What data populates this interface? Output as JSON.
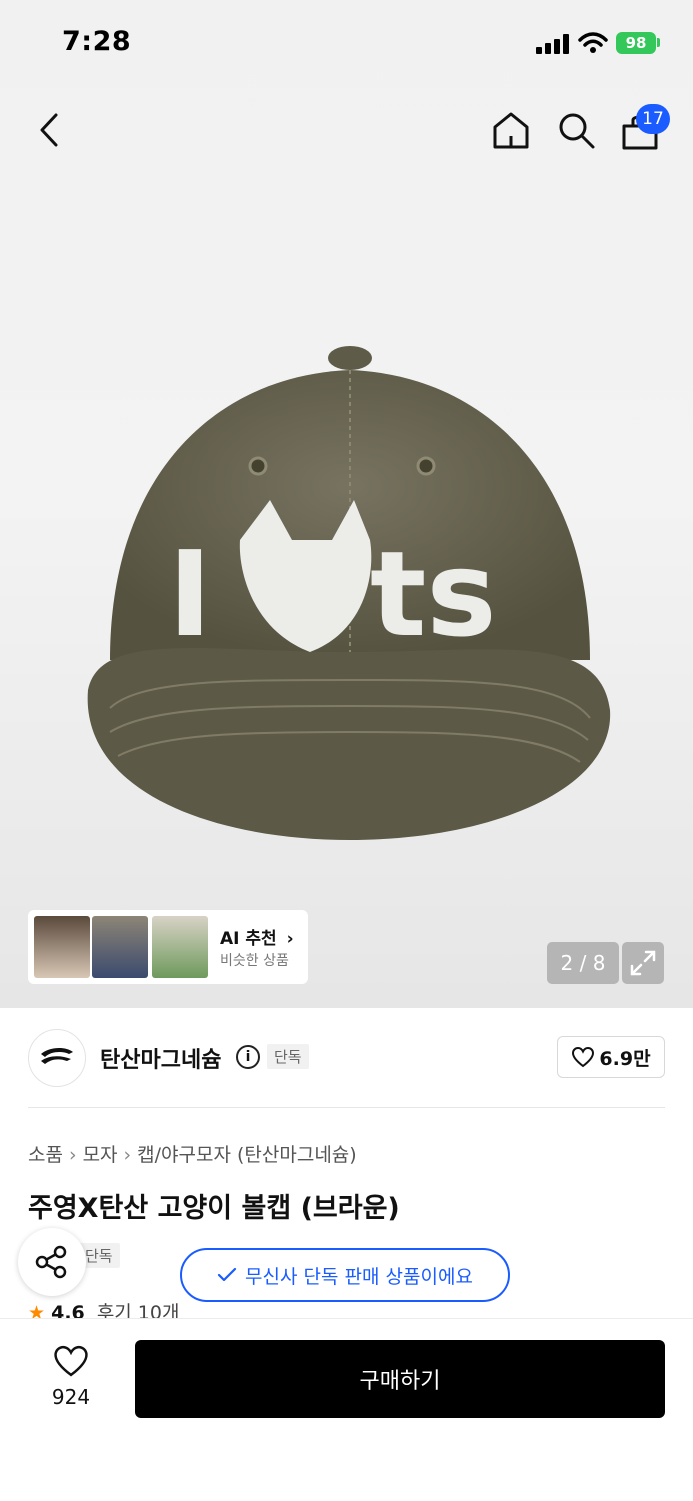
{
  "status_bar": {
    "time": "7:28",
    "battery": "98"
  },
  "header": {
    "cart_count": "17"
  },
  "gallery": {
    "ai_title": "AI 추천",
    "ai_subtitle": "비슷한 상품",
    "page_indicator": "2 / 8"
  },
  "cap_text": "I ts",
  "brand": {
    "name": "탄산마그네슘",
    "tag": "단독",
    "likes": "6.9만"
  },
  "breadcrumb": [
    "소품",
    "모자",
    "캡/야구모자 (탄산마그네슘)"
  ],
  "product": {
    "title": "주영X탄산 고양이 볼캡 (브라운)",
    "tag": "단독",
    "exclusive_notice": "무신사 단독 판매 상품이에요",
    "rating": "4.6",
    "reviews": "후기 10개"
  },
  "bottom_bar": {
    "wish_count": "924",
    "buy_label": "구매하기"
  },
  "colors": {
    "accent": "#1a5cff",
    "battery": "#34c759",
    "buy_button": "#000000",
    "star": "#ff8a00"
  }
}
